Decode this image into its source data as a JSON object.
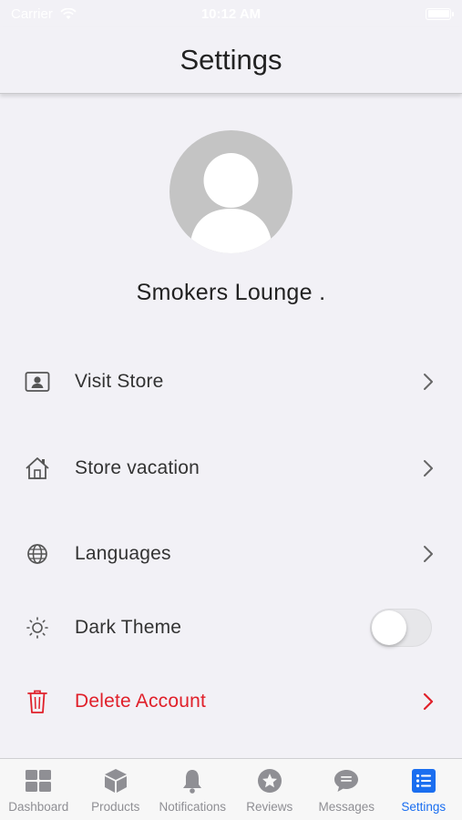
{
  "status_bar": {
    "carrier": "Carrier",
    "time": "10:12 AM"
  },
  "header": {
    "title": "Settings"
  },
  "profile": {
    "name": "Smokers Lounge ."
  },
  "menu": {
    "visit_store": {
      "label": "Visit Store",
      "icon": "id-card-icon"
    },
    "store_vacation": {
      "label": "Store vacation",
      "icon": "house-icon"
    },
    "languages": {
      "label": "Languages",
      "icon": "globe-icon"
    },
    "dark_theme": {
      "label": "Dark Theme",
      "icon": "sun-icon",
      "enabled": false
    },
    "delete_account": {
      "label": "Delete Account",
      "icon": "trash-icon",
      "color": "#e0202a"
    }
  },
  "tab_bar": {
    "active_color": "#1a6ef0",
    "inactive_color": "#8f8f94",
    "tabs": [
      {
        "label": "Dashboard",
        "icon": "grid-icon",
        "active": false
      },
      {
        "label": "Products",
        "icon": "box-icon",
        "active": false
      },
      {
        "label": "Notifications",
        "icon": "bell-icon",
        "active": false
      },
      {
        "label": "Reviews",
        "icon": "star-icon",
        "active": false
      },
      {
        "label": "Messages",
        "icon": "chat-bubble-icon",
        "active": false
      },
      {
        "label": "Settings",
        "icon": "list-icon",
        "active": true
      }
    ]
  }
}
